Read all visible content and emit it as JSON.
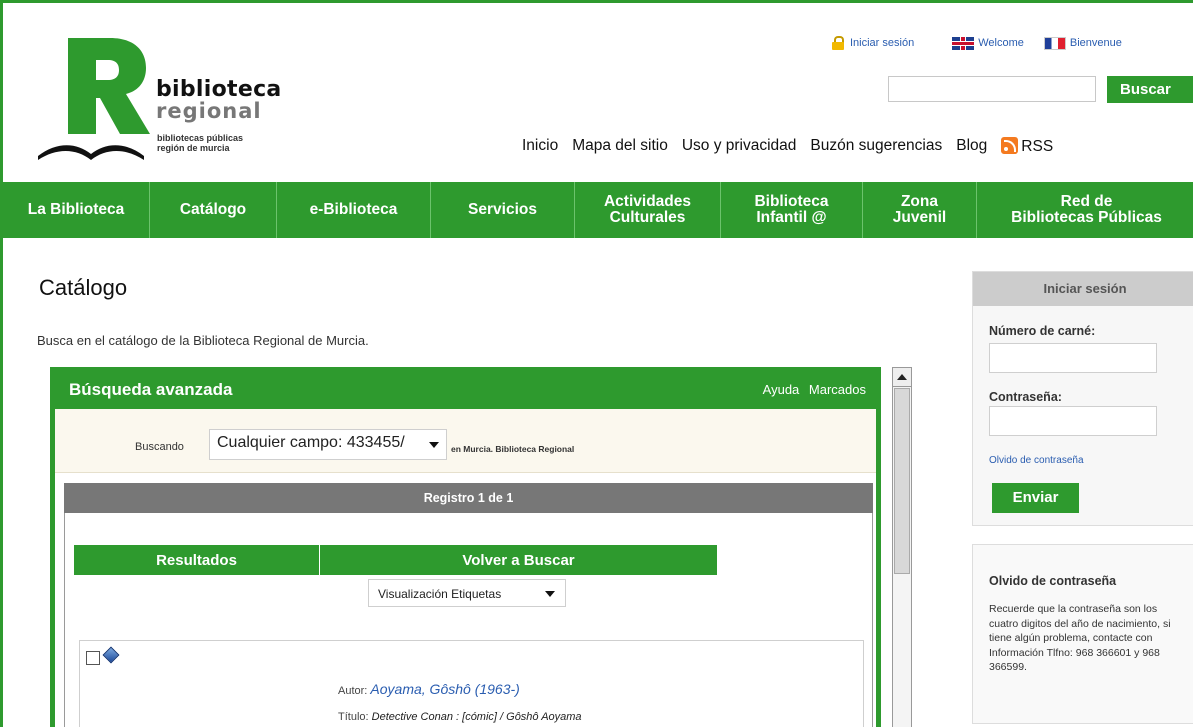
{
  "brand": {
    "name": "biblioteca",
    "sub": "regional",
    "tag1": "bibliotecas públicas",
    "tag2": "región de murcia"
  },
  "top_links": {
    "login": "Iniciar sesión",
    "welcome": "Welcome",
    "bienvenue": "Bienvenue"
  },
  "search": {
    "placeholder": "",
    "button": "Buscar"
  },
  "util_nav": [
    "Inicio",
    "Mapa del sitio",
    "Uso y privacidad",
    "Buzón sugerencias",
    "Blog",
    "RSS"
  ],
  "main_nav": [
    {
      "label": "La Biblioteca"
    },
    {
      "label": "Catálogo"
    },
    {
      "label": "e-Biblioteca"
    },
    {
      "label": "Servicios"
    },
    {
      "label": "Actividades\nCulturales"
    },
    {
      "label": "Biblioteca\nInfantil @"
    },
    {
      "label": "Zona\nJuvenil"
    },
    {
      "label": "Red de\nBibliotecas Públicas"
    }
  ],
  "page": {
    "title": "Catálogo",
    "description": "Busca en el catálogo de la Biblioteca Regional de Murcia."
  },
  "advanced": {
    "title": "Búsqueda avanzada",
    "help": "Ayuda",
    "bookmarks": "Marcados",
    "searching_label": "Buscando",
    "field_value": "Cualquier campo: 433455/",
    "location": "en Murcia. Biblioteca Regional",
    "record_bar": "Registro 1 de 1",
    "tabs": [
      "Resultados",
      "Volver a Buscar"
    ],
    "view_mode": "Visualización Etiquetas",
    "author_label": "Autor:",
    "author_value": "Aoyama, Gôshô (1963-)",
    "title_label": "Título:",
    "title_value": "Detective Conan : [cómic] / Gôshô Aoyama"
  },
  "sidebar": {
    "login_title": "Iniciar sesión",
    "card_label": "Número de carné:",
    "password_label": "Contraseña:",
    "forgot_link": "Olvido de contraseña",
    "submit": "Enviar",
    "info_title": "Olvido de contraseña",
    "info_text": "Recuerde que la contraseña son los cuatro digitos del año de nacimiento, si tiene algún problema, contacte con Información Tlfno: 968 366601 y 968 366599."
  },
  "colors": {
    "accent": "#2e9a2e",
    "link": "#2a5db0",
    "record_bar": "#777777"
  }
}
